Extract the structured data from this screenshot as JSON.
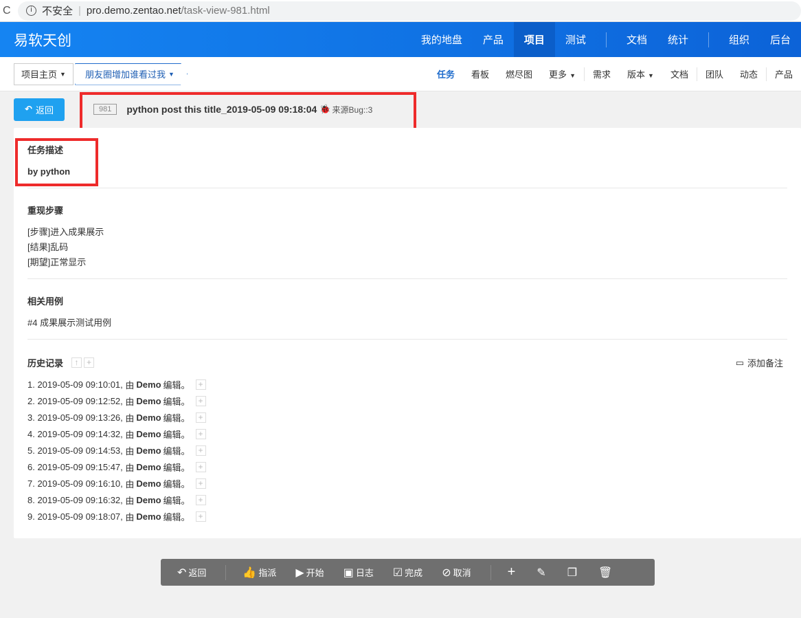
{
  "browser": {
    "security": "不安全",
    "url_host": "pro.demo.zentao.net",
    "url_path": "/task-view-981.html"
  },
  "brand": "易软天创",
  "main_nav": [
    "我的地盘",
    "产品",
    "项目",
    "测试",
    "文档",
    "统计",
    "组织",
    "后台"
  ],
  "breadcrumb": {
    "home": "项目主页",
    "project": "朋友圈增加谁看过我"
  },
  "sub_nav": [
    "任务",
    "看板",
    "燃尽图",
    "更多",
    "需求",
    "版本",
    "文档",
    "团队",
    "动态",
    "产品"
  ],
  "back_label": "返回",
  "task": {
    "id": "981",
    "title": "python post this title_2019-05-09 09:18:04",
    "source": "来源Bug::3"
  },
  "description": {
    "heading": "任务描述",
    "text": "by python"
  },
  "steps": {
    "heading": "重现步骤",
    "lines": [
      "[步骤]进入成果展示",
      "[结果]乱码",
      "[期望]正常显示"
    ]
  },
  "cases": {
    "heading": "相关用例",
    "text": "#4 成果展示测试用例"
  },
  "history": {
    "heading": "历史记录",
    "add_note": "添加备注",
    "by": "由",
    "user": "Demo",
    "action": "编辑。",
    "items": [
      "1. 2019-05-09 09:10:01,",
      "2. 2019-05-09 09:12:52,",
      "3. 2019-05-09 09:13:26,",
      "4. 2019-05-09 09:14:32,",
      "5. 2019-05-09 09:14:53,",
      "6. 2019-05-09 09:15:47,",
      "7. 2019-05-09 09:16:10,",
      "8. 2019-05-09 09:16:32,",
      "9. 2019-05-09 09:18:07,"
    ]
  },
  "toolbar": {
    "back": "返回",
    "assign": "指派",
    "start": "开始",
    "log": "日志",
    "finish": "完成",
    "cancel": "取消"
  }
}
